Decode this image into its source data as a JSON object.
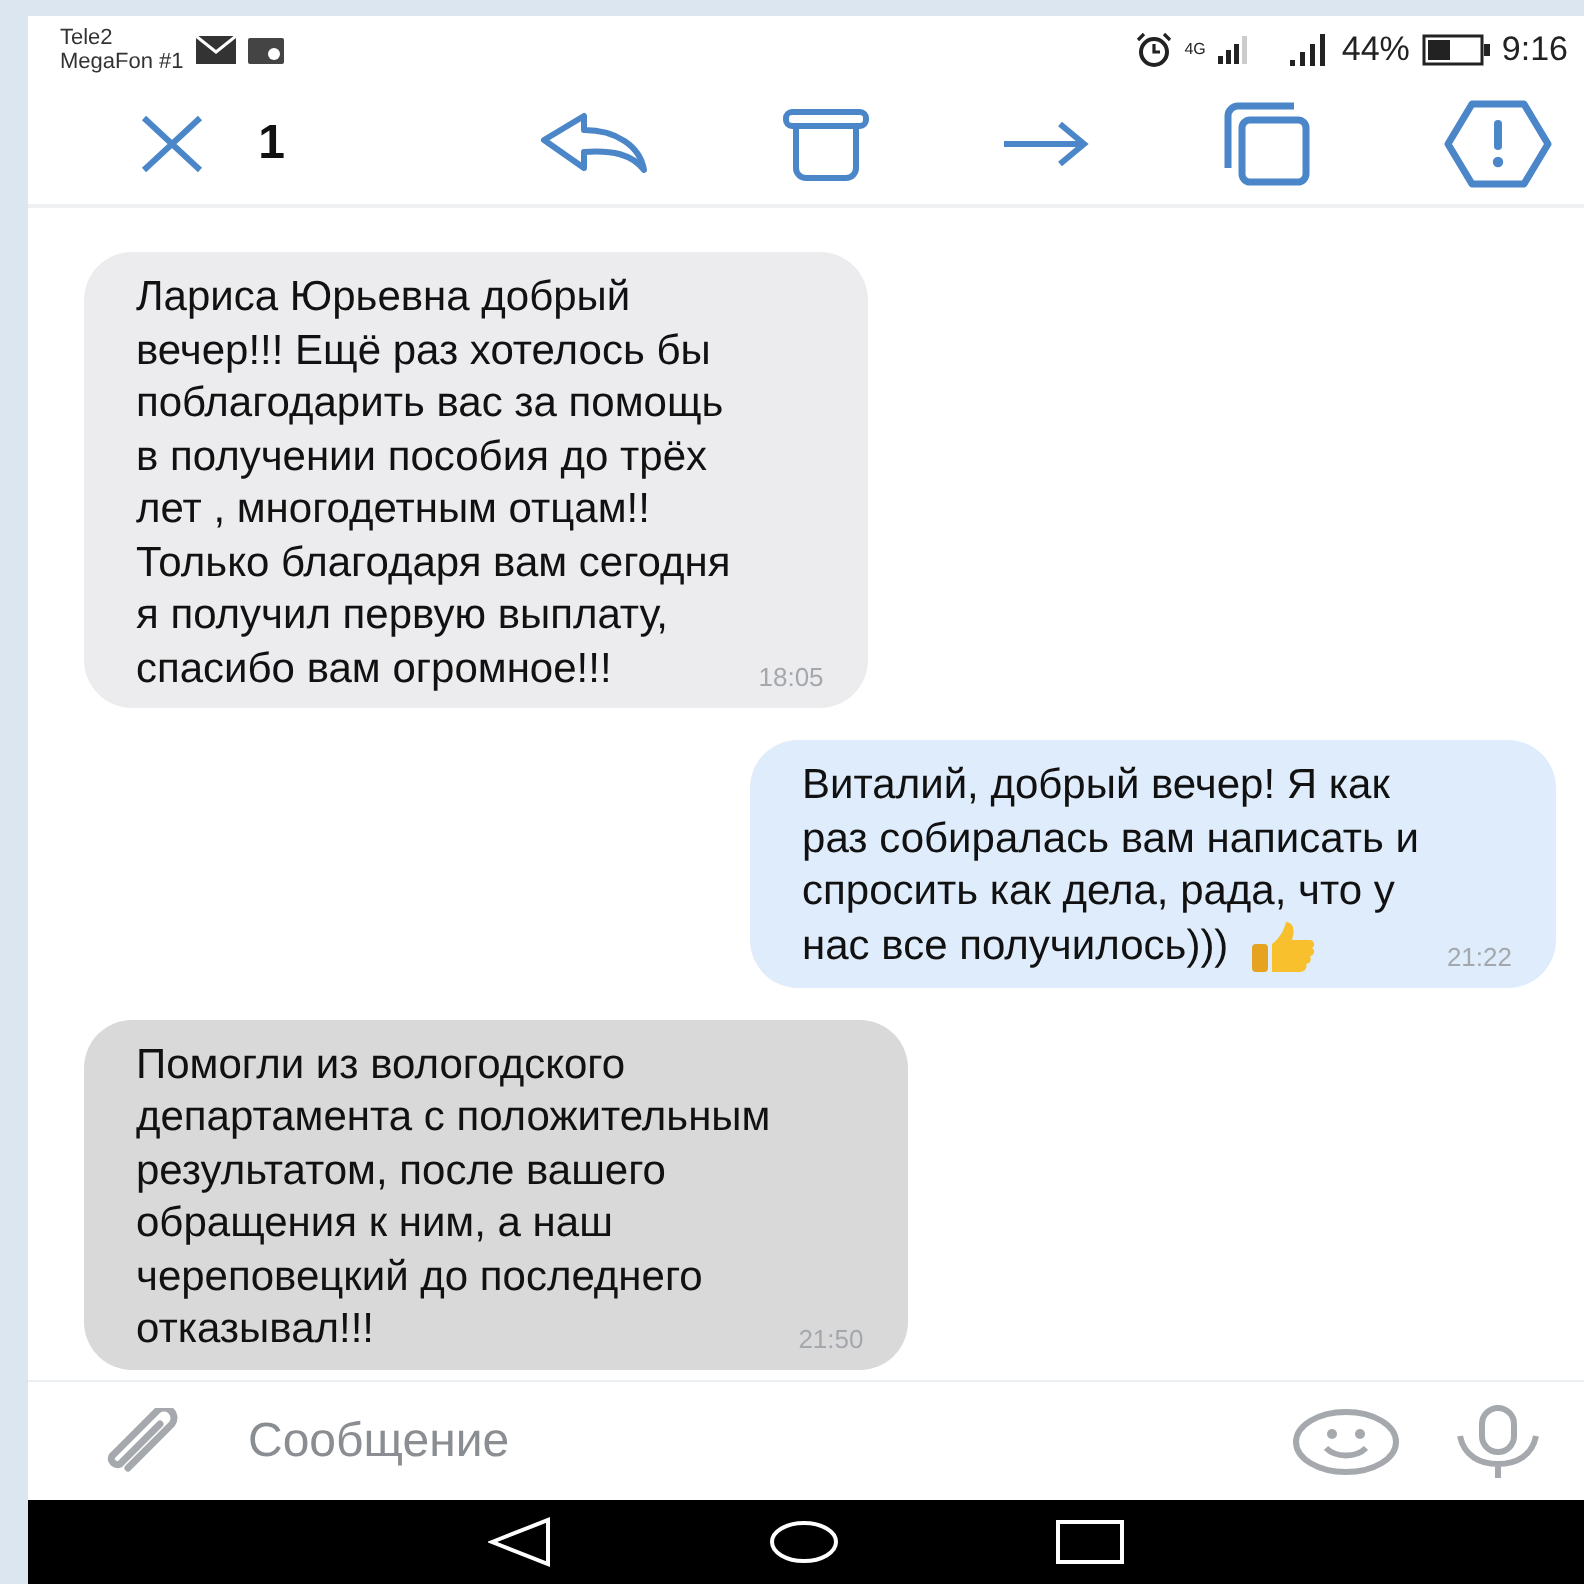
{
  "status_bar": {
    "carriers": [
      "Tele2",
      "MegaFon #1"
    ],
    "network": "4G",
    "battery_text": "44%",
    "time": "9:16"
  },
  "toolbar": {
    "selected_count": "1"
  },
  "messages": [
    {
      "kind": "incoming",
      "selected": false,
      "lines": [
        "Лариса Юрьевна добрый",
        "вечер!!! Ещё раз хотелось бы",
        "поблагодарить вас за помощь",
        "в получении пособия до трёх",
        "лет , многодетным отцам!!",
        "Только благодаря вам сегодня",
        "я получил первую выплату,",
        "спасибо вам огромное!!!"
      ],
      "time": "18:05"
    },
    {
      "kind": "outgoing",
      "selected": false,
      "lines": [
        "Виталий, добрый вечер! Я как",
        "раз собиралась вам написать и",
        "спросить как дела, рада, что у",
        "нас все получилось)))"
      ],
      "thumbs_up": true,
      "time": "21:22"
    },
    {
      "kind": "incoming",
      "selected": true,
      "lines": [
        "Помогли из вологодского",
        "департамента с положительным",
        "результатом, после вашего",
        "обращения к ним, а наш",
        "череповецкий до последнего",
        "отказывал!!!"
      ],
      "time": "21:50"
    }
  ],
  "composer": {
    "placeholder": "Сообщение"
  }
}
